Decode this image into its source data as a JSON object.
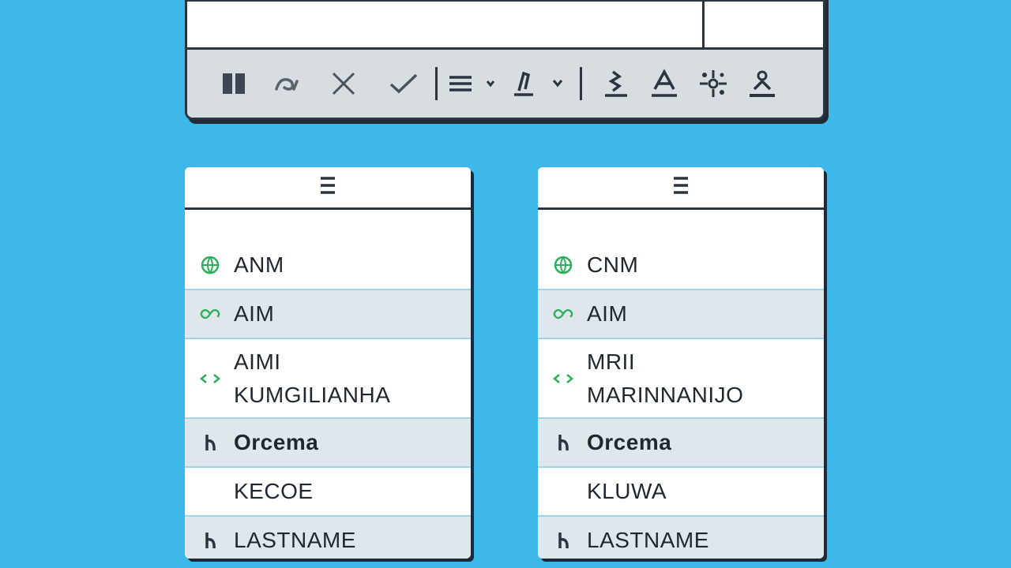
{
  "colors": {
    "background": "#3db8e8",
    "frame": "#2b3440",
    "toolbar_strip": "#d8dde2",
    "row_alt": "#dfe6ec",
    "row_divider": "#9fd3ee",
    "icon_green": "#2fae5c"
  },
  "toolbar": {
    "buttons": [
      {
        "icon": "pause-icon"
      },
      {
        "icon": "undo-icon"
      },
      {
        "icon": "close-icon"
      },
      {
        "icon": "check-icon"
      },
      {
        "icon": "align-dropdown-icon"
      },
      {
        "icon": "text-style-dropdown-icon"
      },
      {
        "icon": "format-a-icon"
      },
      {
        "icon": "font-color-icon"
      },
      {
        "icon": "effects-icon"
      },
      {
        "icon": "person-format-icon"
      }
    ]
  },
  "panels": [
    {
      "header_icon": "menu-icon",
      "rows": [
        {
          "icon": "globe-icon",
          "label": "ANM",
          "alt": false
        },
        {
          "icon": "infinity-icon",
          "label": "AIM",
          "alt": true
        },
        {
          "icon": "code-icon",
          "label_line1": "AIMI",
          "label_line2": "KUMGILIANHA",
          "alt": false
        },
        {
          "icon": "person-icon",
          "label": "Orcema",
          "alt": true,
          "bold": true
        },
        {
          "icon": "",
          "label": "KECOE",
          "alt": false
        },
        {
          "icon": "person-icon",
          "label": "LASTNAME",
          "alt": true
        }
      ]
    },
    {
      "header_icon": "menu-icon",
      "rows": [
        {
          "icon": "globe-icon",
          "label": "CNM",
          "alt": false
        },
        {
          "icon": "infinity-icon",
          "label": "AIM",
          "alt": true
        },
        {
          "icon": "code-icon",
          "label_line1": "MRII",
          "label_line2": "MARINNANIJO",
          "alt": false
        },
        {
          "icon": "person-icon",
          "label": "Orcema",
          "alt": true,
          "bold": true
        },
        {
          "icon": "",
          "label": "KLUWA",
          "alt": false
        },
        {
          "icon": "person-icon",
          "label": "LASTNAME",
          "alt": true
        }
      ]
    }
  ]
}
